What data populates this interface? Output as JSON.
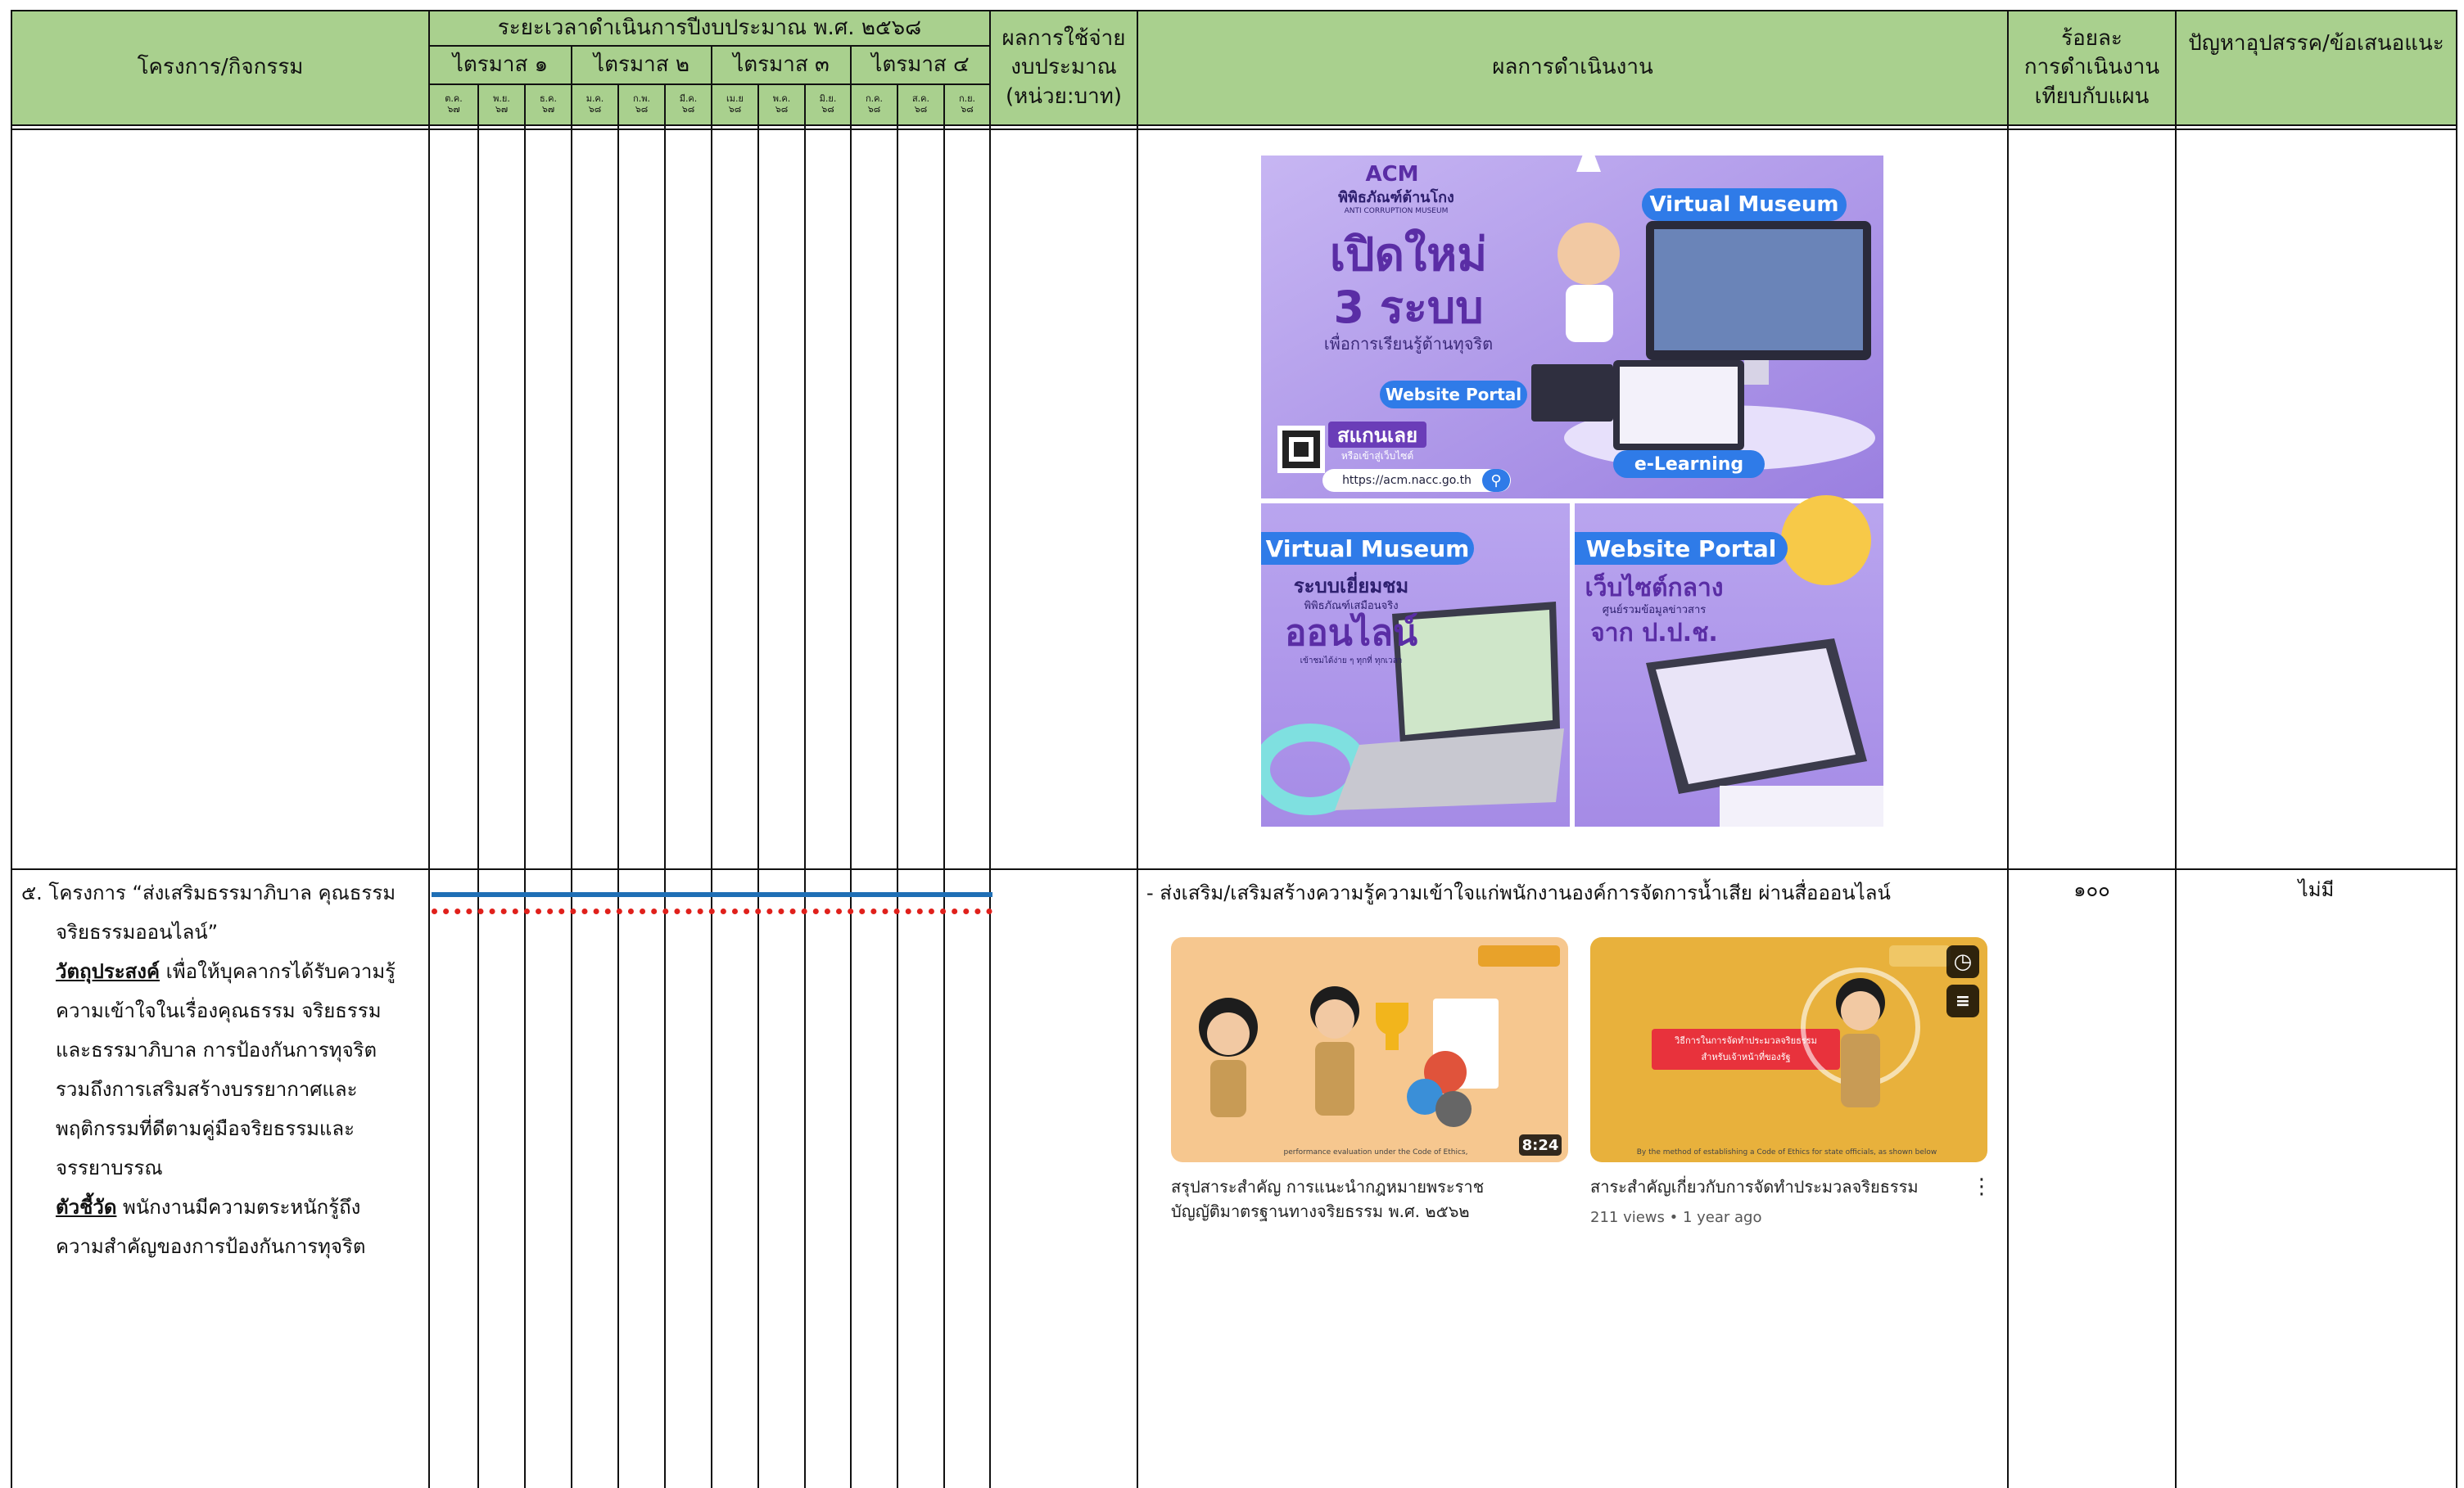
{
  "header": {
    "project_col": "โครงการ/กิจกรรม",
    "timeline_title": "ระยะเวลาดำเนินการปีงบประมาณ พ.ศ. ๒๕๖๘",
    "quarters": [
      "ไตรมาส ๑",
      "ไตรมาส ๒",
      "ไตรมาส ๓",
      "ไตรมาส ๔"
    ],
    "months": [
      {
        "m": "ต.ค.",
        "y": "๖๗"
      },
      {
        "m": "พ.ย.",
        "y": "๖๗"
      },
      {
        "m": "ธ.ค.",
        "y": "๖๗"
      },
      {
        "m": "ม.ค.",
        "y": "๖๘"
      },
      {
        "m": "ก.พ.",
        "y": "๖๘"
      },
      {
        "m": "มี.ค.",
        "y": "๖๘"
      },
      {
        "m": "เม.ย",
        "y": "๖๘"
      },
      {
        "m": "พ.ค.",
        "y": "๖๘"
      },
      {
        "m": "มิ.ย.",
        "y": "๖๘"
      },
      {
        "m": "ก.ค.",
        "y": "๖๘"
      },
      {
        "m": "ส.ค.",
        "y": "๖๘"
      },
      {
        "m": "ก.ย.",
        "y": "๖๘"
      }
    ],
    "budget_line1": "ผลการใช้จ่าย",
    "budget_line2": "งบประมาณ",
    "budget_line3": "(หน่วย:บาท)",
    "results_col": "ผลการดำเนินงาน",
    "percent_line1": "ร้อยละ",
    "percent_line2": "การดำเนินงาน",
    "percent_line3": "เทียบกับแผน",
    "problems_col": "ปัญหาอุปสรรค/ข้อเสนอแนะ"
  },
  "poster": {
    "logo_text": "ACM",
    "museum_name_th": "พิพิธภัณฑ์ต้านโกง",
    "museum_name_en": "ANTI CORRUPTION MUSEUM",
    "headline1": "เปิดใหม่",
    "headline2": "3 ระบบ",
    "headline_sub": "เพื่อการเรียนรู้ต้านทุจริต",
    "virtual_museum": "Virtual Museum",
    "website_portal": "Website Portal",
    "scan_label": "สแกนเลย",
    "scan_sub": "หรือเข้าสู่เว็บไซต์",
    "url": "https://acm.nacc.go.th",
    "elearning": "e-Learning",
    "vm_title": "Virtual Museum",
    "vm_line1": "ระบบเยี่ยมชม",
    "vm_line2": "พิพิธภัณฑ์เสมือนจริง",
    "vm_line3": "ออนไลน์",
    "vm_line4": "เข้าชมได้ง่าย ๆ ทุกที่ ทุกเวลา",
    "wp_title": "Website Portal",
    "wp_line1": "เว็บไซต์กลาง",
    "wp_line2": "ศูนย์รวมข้อมูลข่าวสาร",
    "wp_line3": "จาก ป.ป.ช."
  },
  "row2": {
    "project_title_line1": "๕. โครงการ “ส่งเสริมธรรมาภิบาล คุณธรรม",
    "project_title_line2": "จริยธรรมออนไลน์”",
    "objective_label": "วัตถุประสงค์",
    "objective_line1": " เพื่อให้บุคลากรได้รับความรู้",
    "objective_line2": "ความเข้าใจในเรื่องคุณธรรม จริยธรรม",
    "objective_line3": "และธรรมาภิบาล การป้องกันการทุจริต",
    "objective_line4": "รวมถึงการเสริมสร้างบรรยากาศและ",
    "objective_line5": "พฤติกรรมที่ดีตามคู่มือจริยธรรมและ",
    "objective_line6": "จรรยาบรรณ",
    "indicator_label": "ตัวชี้วัด",
    "indicator_line1": " พนักงานมีความตระหนักรู้ถึง",
    "indicator_line2": "ความสำคัญของการป้องกันการทุจริต",
    "result_text": "-  ส่งเสริม/เสริมสร้างความรู้ความเข้าใจแก่พนักงานองค์การจัดการน้ำเสีย ผ่านสื่อออนไลน์",
    "percent": "๑๐๐",
    "problems": "ไม่มี",
    "video1": {
      "title_line1": "สรุปสาระสำคัญ การแนะนำกฎหมายพระราช",
      "title_line2": "บัญญัติมาตรฐานทางจริยธรรม พ.ศ. ๒๕๖๒",
      "duration": "8:24",
      "caption": "performance evaluation under the Code of Ethics,"
    },
    "video2": {
      "title": "สาระสำคัญเกี่ยวกับการจัดทำประมวลจริยธรรม",
      "meta": "211 views • 1 year ago",
      "banner_line1": "วิธีการในการจัดทำประมวลจริยธรรม",
      "banner_line2": "สำหรับเจ้าหน้าที่ของรัฐ",
      "caption": "By the method of establishing a Code of Ethics for state officials, as shown below"
    }
  },
  "colors": {
    "header_green": "#a9d08e",
    "plan_line": "#1f6fb5",
    "actual_line": "#e0201b",
    "poster_purple": "#a58be6",
    "thumb1_bg": "#f6c78f",
    "thumb2_bg": "#e8b13c"
  }
}
